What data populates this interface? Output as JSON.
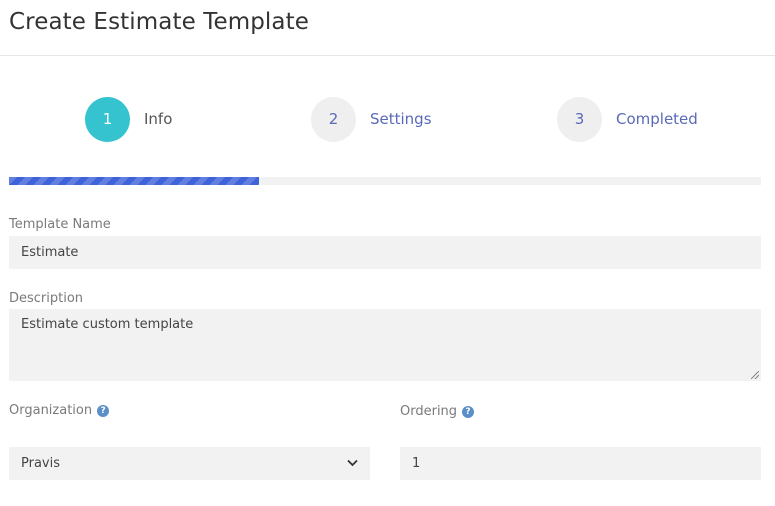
{
  "header": {
    "title": "Create Estimate Template"
  },
  "steps": [
    {
      "number": "1",
      "label": "Info"
    },
    {
      "number": "2",
      "label": "Settings"
    },
    {
      "number": "3",
      "label": "Completed"
    }
  ],
  "progress": {
    "value": 0.333
  },
  "form": {
    "template_name": {
      "label": "Template Name",
      "value": "Estimate"
    },
    "description": {
      "label": "Description",
      "value": "Estimate custom template"
    },
    "organization": {
      "label": "Organization",
      "value": "Pravis"
    },
    "ordering": {
      "label": "Ordering",
      "value": "1"
    }
  },
  "icons": {
    "help": "question-circle-icon",
    "dropdown": "chevron-down-icon"
  },
  "colors": {
    "active_step": "#35c3d0",
    "step_link": "#5a6ab8",
    "progress": "#3e63d8"
  }
}
